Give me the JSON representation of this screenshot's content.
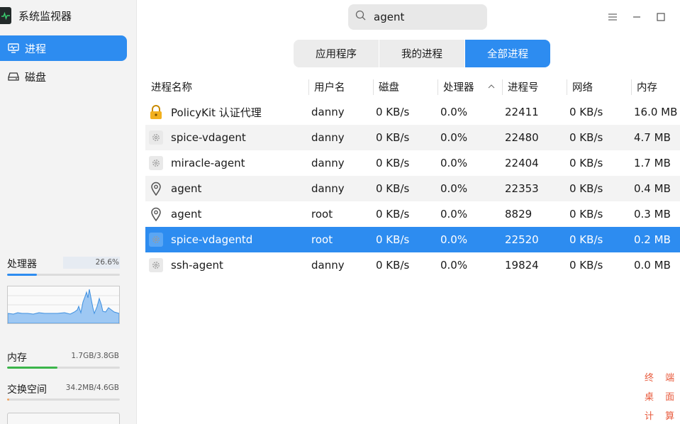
{
  "app": {
    "title": "系统监视器"
  },
  "sidebar": {
    "nav": [
      {
        "label": "进程",
        "icon": "monitor-icon",
        "active": true
      },
      {
        "label": "磁盘",
        "icon": "disk-icon",
        "active": false
      }
    ],
    "cpu": {
      "label": "处理器",
      "value": "26.6%",
      "percent": 26.6,
      "color": "#2d8cf0"
    },
    "memory": {
      "label": "内存",
      "value": "1.7GB/3.8GB",
      "fraction": 0.447,
      "color": "#3bb54a"
    },
    "swap": {
      "label": "交换空间",
      "value": "34.2MB/4.6GB",
      "fraction": 0.007,
      "color": "#f4a35c"
    }
  },
  "search": {
    "value": "agent",
    "placeholder": ""
  },
  "tabs": [
    {
      "label": "应用程序",
      "active": false
    },
    {
      "label": "我的进程",
      "active": false
    },
    {
      "label": "全部进程",
      "active": true
    }
  ],
  "table": {
    "columns": [
      "进程名称",
      "用户名",
      "磁盘",
      "处理器",
      "进程号",
      "网络",
      "内存"
    ],
    "sort_column": "处理器",
    "rows": [
      {
        "icon": "lock-icon",
        "name": "PolicyKit 认证代理",
        "user": "danny",
        "disk": "0 KB/s",
        "cpu": "0.0%",
        "pid": "22411",
        "net": "0 KB/s",
        "mem": "16.0 MB"
      },
      {
        "icon": "gear-icon",
        "name": "spice-vdagent",
        "user": "danny",
        "disk": "0 KB/s",
        "cpu": "0.0%",
        "pid": "22480",
        "net": "0 KB/s",
        "mem": "4.7 MB"
      },
      {
        "icon": "gear-icon",
        "name": "miracle-agent",
        "user": "danny",
        "disk": "0 KB/s",
        "cpu": "0.0%",
        "pid": "22404",
        "net": "0 KB/s",
        "mem": "1.7 MB"
      },
      {
        "icon": "pin-icon",
        "name": "agent",
        "user": "danny",
        "disk": "0 KB/s",
        "cpu": "0.0%",
        "pid": "22353",
        "net": "0 KB/s",
        "mem": "0.4 MB"
      },
      {
        "icon": "pin-icon",
        "name": "agent",
        "user": "root",
        "disk": "0 KB/s",
        "cpu": "0.0%",
        "pid": "8829",
        "net": "0 KB/s",
        "mem": "0.3 MB"
      },
      {
        "icon": "gear-icon",
        "name": "spice-vdagentd",
        "user": "root",
        "disk": "0 KB/s",
        "cpu": "0.0%",
        "pid": "22520",
        "net": "0 KB/s",
        "mem": "0.2 MB",
        "selected": true
      },
      {
        "icon": "gear-icon",
        "name": "ssh-agent",
        "user": "danny",
        "disk": "0 KB/s",
        "cpu": "0.0%",
        "pid": "19824",
        "net": "0 KB/s",
        "mem": "0.0 MB"
      }
    ]
  },
  "watermark": {
    "lines": [
      "终 端 序",
      "桌 面 名",
      "计 算 机"
    ]
  }
}
